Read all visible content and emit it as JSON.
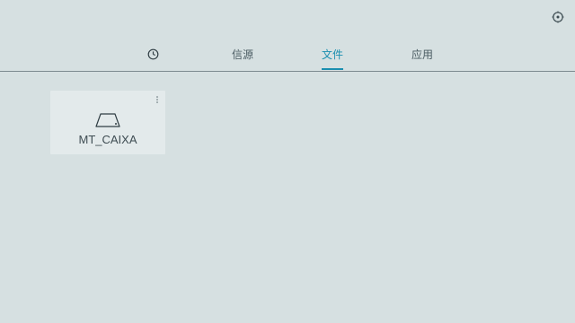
{
  "header": {
    "settings_icon": "gear-icon"
  },
  "nav": {
    "tabs": [
      {
        "type": "icon",
        "icon": "clock-icon"
      },
      {
        "label": "信源"
      },
      {
        "label": "文件",
        "active": true
      },
      {
        "label": "应用"
      }
    ],
    "accent_color": "#1b8fb0"
  },
  "files": {
    "items": [
      {
        "name": "MT_CAIXA",
        "icon": "storage-drive-icon",
        "menu_icon": "more-vertical-icon"
      }
    ]
  },
  "colors": {
    "background": "#d6e0e1",
    "card_background": "#e3eaeb",
    "text": "#4a5b62"
  }
}
